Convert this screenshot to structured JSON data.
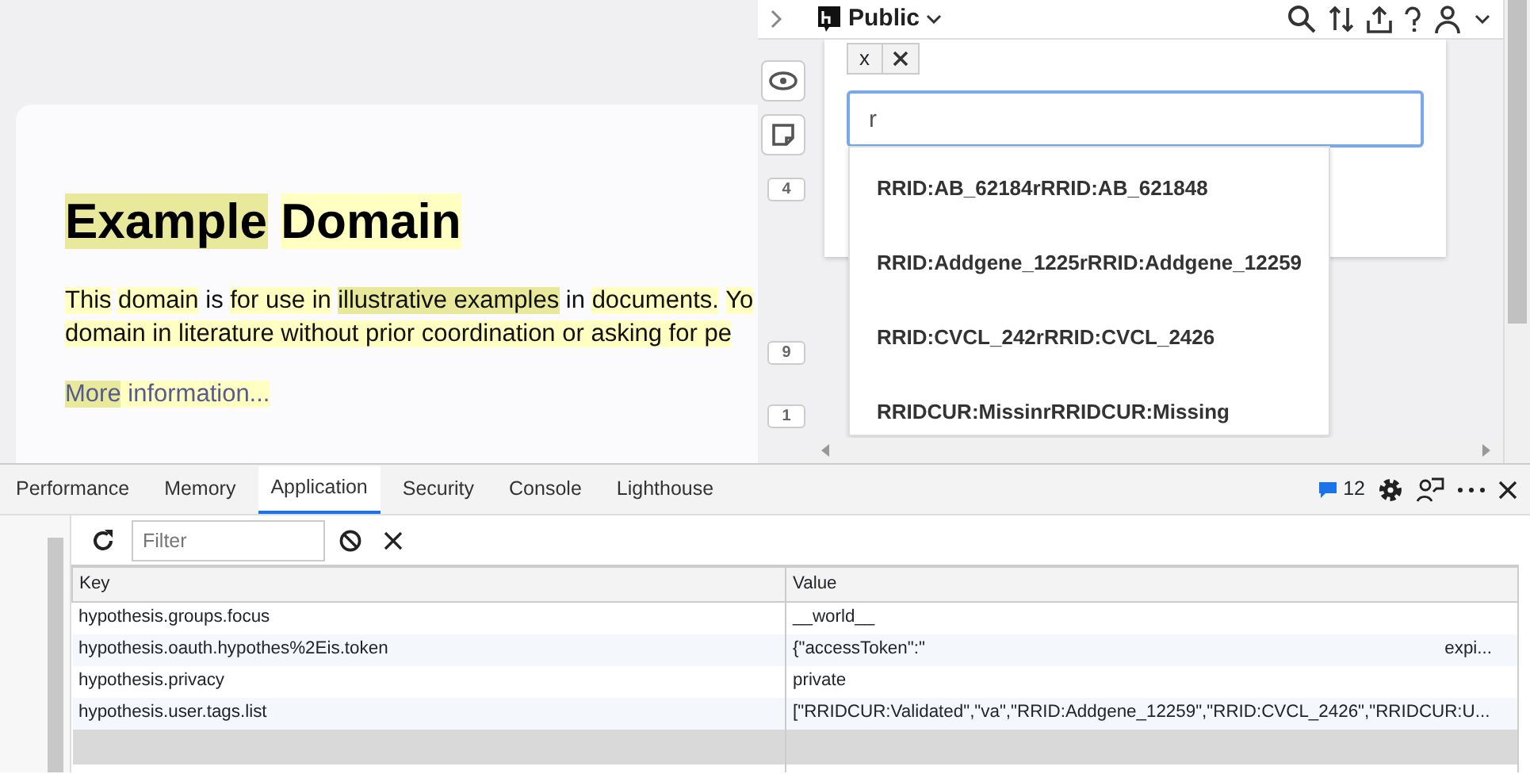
{
  "page": {
    "heading": [
      {
        "text": "Example",
        "highlighted": true,
        "focused": true
      },
      {
        "text": "Domain",
        "highlighted": true,
        "focused": false
      }
    ],
    "paragraph": [
      [
        {
          "text": "This",
          "highlighted": true,
          "focused": false
        },
        {
          "text": "domain",
          "highlighted": true,
          "focused": false
        },
        {
          "text": " is ",
          "highlighted": false
        },
        {
          "text": "for use in",
          "highlighted": true,
          "focused": false
        },
        {
          "text": "illustrative examples",
          "highlighted": true,
          "focused": true
        },
        {
          "text": " in ",
          "highlighted": false
        },
        {
          "text": "documents.",
          "highlighted": true,
          "focused": false
        },
        {
          "text": "Yo",
          "highlighted": true,
          "focused": false
        }
      ],
      [
        {
          "text": "domain in literature without prior coordination or asking for pe",
          "highlighted": true,
          "focused": false
        }
      ]
    ],
    "link": [
      {
        "text": "More",
        "highlighted": true,
        "focused": true
      },
      {
        "text": " information...",
        "highlighted": true,
        "focused": false
      }
    ]
  },
  "sidebar": {
    "group": "Public",
    "buckets": [
      "4",
      "9",
      "1"
    ],
    "tags": [
      {
        "label": "x"
      }
    ],
    "tag_input": {
      "value": "r"
    },
    "suggestions": [
      "RRID:AB_62184rRRID:AB_621848",
      "RRID:Addgene_1225rRRID:Addgene_12259",
      "RRID:CVCL_242rRRID:CVCL_2426",
      "RRIDCUR:MissinrRRIDCUR:Missing"
    ]
  },
  "devtools": {
    "tabs": [
      {
        "label": "Performance",
        "selected": false
      },
      {
        "label": "Memory",
        "selected": false
      },
      {
        "label": "Application",
        "selected": true
      },
      {
        "label": "Security",
        "selected": false
      },
      {
        "label": "Console",
        "selected": false
      },
      {
        "label": "Lighthouse",
        "selected": false
      }
    ],
    "issues": "12",
    "filter": {
      "placeholder": "Filter"
    },
    "table": {
      "columns": [
        "Key",
        "Value"
      ],
      "rows": [
        {
          "key": "hypothesis.groups.focus",
          "value": "__world__"
        },
        {
          "key": "hypothesis.oauth.hypothes%2Eis.token",
          "value": "{\"accessToken\":\"",
          "value_tail": "expi..."
        },
        {
          "key": "hypothesis.privacy",
          "value": "private"
        },
        {
          "key": "hypothesis.user.tags.list",
          "value": "[\"RRIDCUR:Validated\",\"va\",\"RRID:Addgene_12259\",\"RRID:CVCL_2426\",\"RRIDCUR:U..."
        }
      ]
    }
  }
}
